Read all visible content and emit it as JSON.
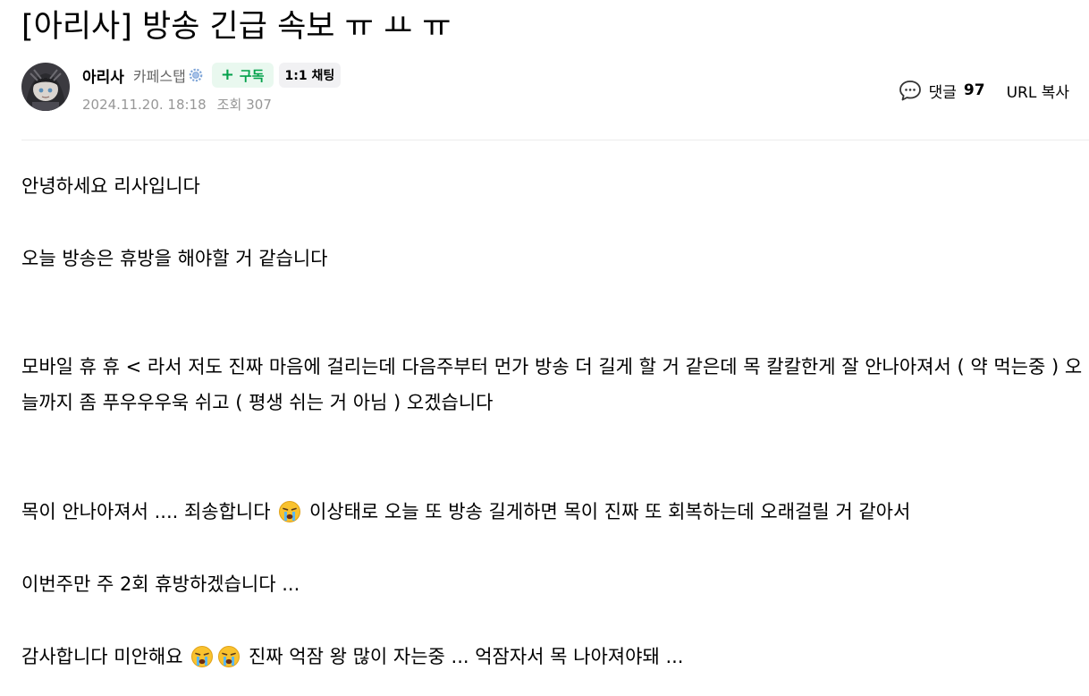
{
  "post": {
    "title": "[아리사] 방송 긴급 속보 ㅠ ㅛ ㅠ"
  },
  "author": {
    "name": "아리사",
    "grade": "카페스탭",
    "subscribe_label": "구독",
    "chat_label": "1:1 채팅"
  },
  "meta": {
    "date": "2024.11.20. 18:18",
    "views_label": "조회",
    "views_value": "307"
  },
  "tools": {
    "comment_label": "댓글",
    "comment_count": "97",
    "url_copy_label": "URL 복사"
  },
  "content": {
    "greeting": "안녕하세요 리사입니다",
    "notice": "오늘 방송은 휴방을 해야할 거 같습니다",
    "explain": "모바일 휴 휴 < 라서 저도 진짜 마음에 걸리는데 다음주부터 먼가 방송 더 길게 할 거 같은데 목 칼칼한게 잘 안나아져서 ( 약 먹는중 ) 오늘까지 좀 푸우우우욱 쉬고 ( 평생 쉬는 거 아님 ) 오겠습니다",
    "sorry_part1": "목이 안나아져서 .... 죄송합니다",
    "sorry_part2": "이상태로 오늘 또 방송 길게하면 목이 진짜 또 회복하는데 오래걸릴 거 같아서",
    "week": "이번주만 주 2회 휴방하겠습니다 ...",
    "thanks_part1": "감사합니다 미안해요",
    "thanks_part2": "진짜 억잠 왕 많이 자는중 ... 억잠자서 목 나아져야돼 ..."
  },
  "icons": {
    "avatar": "avatar-image",
    "grade_badge": "gear-icon",
    "comment": "speech-bubble-icon",
    "emoji": "crying-face-emoji"
  },
  "colors": {
    "subscribe_text": "#03a14b",
    "subscribe_bg": "#e9f8ef",
    "meta_text": "#979797"
  }
}
